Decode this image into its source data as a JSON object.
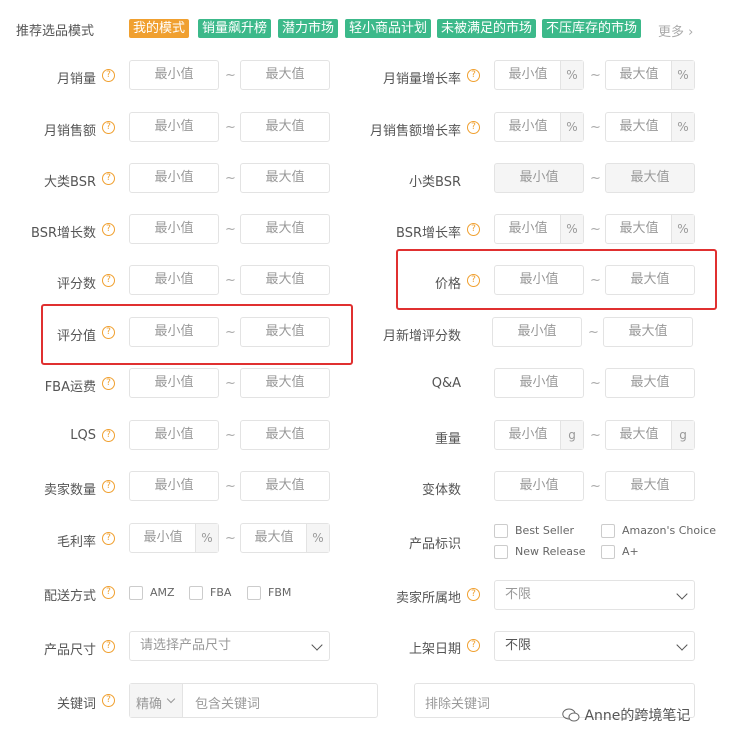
{
  "header": {
    "mode_label": "推荐选品模式",
    "tags": [
      {
        "label": "我的模式",
        "color": "#f0a030"
      },
      {
        "label": "销量飙升榜",
        "color": "#3cb98a"
      },
      {
        "label": "潜力市场",
        "color": "#3cb98a"
      },
      {
        "label": "轻小商品计划",
        "color": "#3cb98a"
      },
      {
        "label": "未被满足的市场",
        "color": "#3cb98a"
      },
      {
        "label": "不压库存的市场",
        "color": "#3cb98a"
      }
    ],
    "more": "更多 ›"
  },
  "placeholders": {
    "min": "最小值",
    "max": "最大值",
    "tilde": "~"
  },
  "units": {
    "percent": "%",
    "gram": "g"
  },
  "left_fields": [
    {
      "label": "月销量"
    },
    {
      "label": "月销售额"
    },
    {
      "label": "大类BSR"
    },
    {
      "label": "BSR增长数"
    },
    {
      "label": "评分数"
    },
    {
      "label": "评分值"
    },
    {
      "label": "FBA运费"
    },
    {
      "label": "LQS"
    },
    {
      "label": "卖家数量"
    },
    {
      "label": "毛利率"
    }
  ],
  "right_fields": [
    {
      "label": "月销量增长率"
    },
    {
      "label": "月销售额增长率"
    },
    {
      "label": "小类BSR"
    },
    {
      "label": "BSR增长率"
    },
    {
      "label": "价格"
    },
    {
      "label": "月新增评分数"
    },
    {
      "label": "Q&A"
    },
    {
      "label": "重量"
    },
    {
      "label": "变体数"
    }
  ],
  "product_tags": {
    "label": "产品标识",
    "options": [
      "Best Seller",
      "Amazon's Choice",
      "New Release",
      "A+"
    ]
  },
  "shipping": {
    "label": "配送方式",
    "options": [
      "AMZ",
      "FBA",
      "FBM"
    ]
  },
  "seller_location": {
    "label": "卖家所属地",
    "value": "不限"
  },
  "product_size": {
    "label": "产品尺寸",
    "placeholder": "请选择产品尺寸"
  },
  "listing_date": {
    "label": "上架日期",
    "value": "不限"
  },
  "keywords": {
    "label": "关键词",
    "match": "精确",
    "include_placeholder": "包含关键词",
    "exclude_placeholder": "排除关键词"
  },
  "watermark": "Anne的跨境笔记"
}
